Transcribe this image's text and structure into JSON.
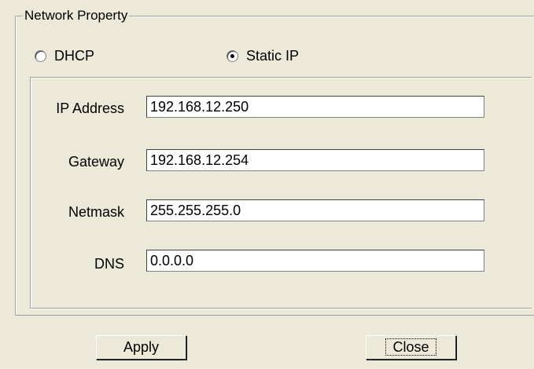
{
  "group": {
    "title": "Network Property"
  },
  "mode": {
    "dhcp_label": "DHCP",
    "static_label": "Static IP",
    "selected": "static"
  },
  "fields": {
    "ip_label": "IP Address",
    "ip_value": "192.168.12.250",
    "gateway_label": "Gateway",
    "gateway_value": "192.168.12.254",
    "netmask_label": "Netmask",
    "netmask_value": "255.255.255.0",
    "dns_label": "DNS",
    "dns_value": "0.0.0.0"
  },
  "buttons": {
    "apply": "Apply",
    "close": "Close"
  }
}
